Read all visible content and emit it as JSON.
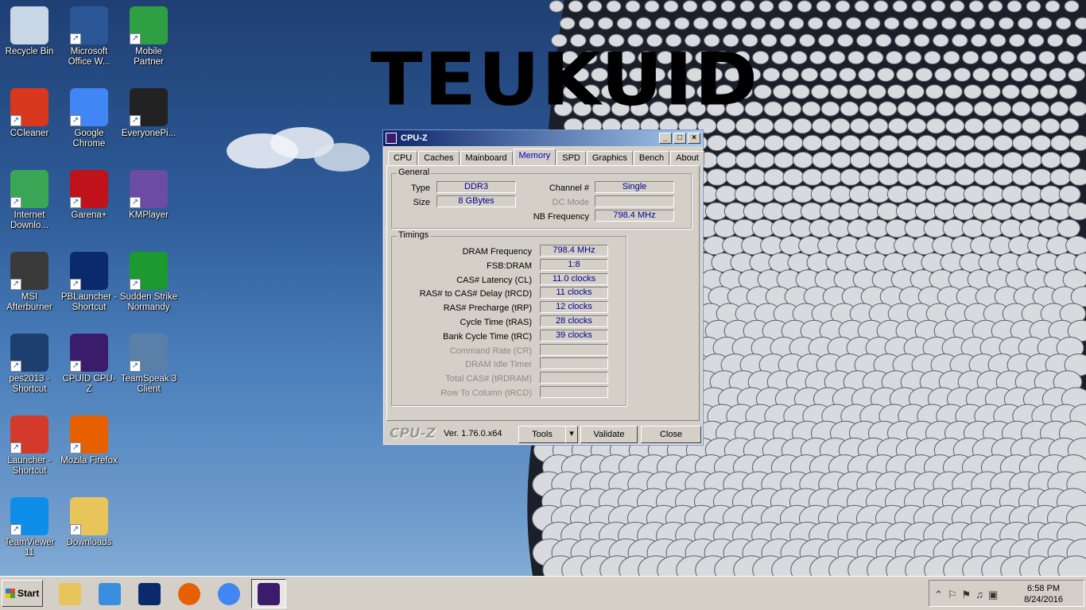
{
  "wallpaper": {
    "overlay_text": "TEUKUID"
  },
  "desktop_icons": [
    {
      "label": "Recycle Bin",
      "icon": "recycle-bin-icon",
      "color": "#c8d6e5"
    },
    {
      "label": "Microsoft Office W...",
      "icon": "word-icon",
      "color": "#2b5797"
    },
    {
      "label": "Mobile Partner",
      "icon": "mobile-partner-icon",
      "color": "#2ea043"
    },
    {
      "label": "CCleaner",
      "icon": "ccleaner-icon",
      "color": "#d9381e"
    },
    {
      "label": "Google Chrome",
      "icon": "chrome-icon",
      "color": "#4285f4"
    },
    {
      "label": "EveryonePi...",
      "icon": "piano-icon",
      "color": "#222222"
    },
    {
      "label": "Internet Downlo...",
      "icon": "idm-icon",
      "color": "#3aa655"
    },
    {
      "label": "Garena+",
      "icon": "garena-icon",
      "color": "#c0121b"
    },
    {
      "label": "KMPlayer",
      "icon": "kmplayer-icon",
      "color": "#6b4ba3"
    },
    {
      "label": "MSI Afterburner",
      "icon": "msi-afterburner-icon",
      "color": "#3a3a3a"
    },
    {
      "label": "PBLauncher - Shortcut",
      "icon": "pblauncher-icon",
      "color": "#0a2a6b"
    },
    {
      "label": "Sudden Strike Normandy",
      "icon": "crosshair-icon",
      "color": "#1c9a2f"
    },
    {
      "label": "pes2013 - Shortcut",
      "icon": "pes-icon",
      "color": "#1d3f6e"
    },
    {
      "label": "CPUID CPU-Z",
      "icon": "cpuz-icon",
      "color": "#3b1b6b"
    },
    {
      "label": "TeamSpeak 3 Client",
      "icon": "teamspeak-icon",
      "color": "#5a7fa8"
    },
    {
      "label": "Launcher - Shortcut",
      "icon": "3dm-icon",
      "color": "#d43a2a"
    },
    {
      "label": "Mozila Firefox",
      "icon": "firefox-icon",
      "color": "#e66000"
    },
    {
      "label": "TeamViewer 11",
      "icon": "teamviewer-icon",
      "color": "#0e8ee9"
    },
    {
      "label": "Downloads",
      "icon": "downloads-folder-icon",
      "color": "#e7c55a"
    }
  ],
  "cpuz": {
    "title": "CPU-Z",
    "tabs": [
      "CPU",
      "Caches",
      "Mainboard",
      "Memory",
      "SPD",
      "Graphics",
      "Bench",
      "About"
    ],
    "active_tab": "Memory",
    "general": {
      "group_label": "General",
      "type_label": "Type",
      "type_value": "DDR3",
      "size_label": "Size",
      "size_value": "8 GBytes",
      "channel_label": "Channel #",
      "channel_value": "Single",
      "dcmode_label": "DC Mode",
      "dcmode_value": "",
      "nbfreq_label": "NB Frequency",
      "nbfreq_value": "798.4 MHz"
    },
    "timings": {
      "group_label": "Timings",
      "rows": [
        {
          "label": "DRAM Frequency",
          "value": "798.4 MHz"
        },
        {
          "label": "FSB:DRAM",
          "value": "1:8"
        },
        {
          "label": "CAS# Latency (CL)",
          "value": "11.0 clocks"
        },
        {
          "label": "RAS# to CAS# Delay (tRCD)",
          "value": "11 clocks"
        },
        {
          "label": "RAS# Precharge (tRP)",
          "value": "12 clocks"
        },
        {
          "label": "Cycle Time (tRAS)",
          "value": "28 clocks"
        },
        {
          "label": "Bank Cycle Time (tRC)",
          "value": "39 clocks"
        },
        {
          "label": "Command Rate (CR)",
          "value": ""
        },
        {
          "label": "DRAM Idle Timer",
          "value": ""
        },
        {
          "label": "Total CAS# (tRDRAM)",
          "value": ""
        },
        {
          "label": "Row To Column (tRCD)",
          "value": ""
        }
      ]
    },
    "footer": {
      "logo": "CPU-Z",
      "version": "Ver. 1.76.0.x64",
      "tools": "Tools",
      "validate": "Validate",
      "close": "Close"
    }
  },
  "taskbar": {
    "start_label": "Start",
    "items": [
      "explorer-icon",
      "media-center-icon",
      "photoshop-icon",
      "firefox-icon",
      "chrome-icon",
      "cpuz-icon"
    ],
    "clock_time": "6:58 PM",
    "clock_date": "8/24/2016"
  }
}
